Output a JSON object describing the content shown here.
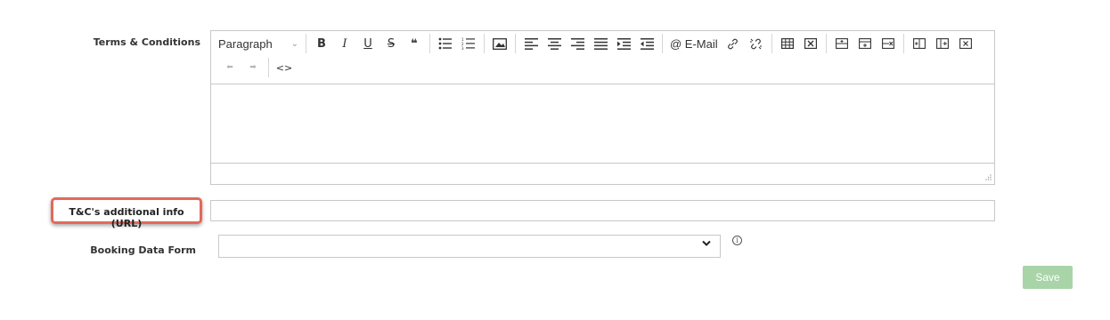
{
  "form": {
    "terms_label": "Terms & Conditions",
    "tc_url_label": "T&C's additional info (URL)",
    "booking_form_label": "Booking Data Form",
    "tc_url_value": "",
    "booking_form_selected": ""
  },
  "toolbar": {
    "paragraph_label": "Paragraph",
    "caret": "⌄",
    "bold": "B",
    "italic": "I",
    "underline": "U",
    "strike": "S",
    "quote": "❝",
    "email_label": "@ E-Mail",
    "undo": "⬅",
    "redo": "➡",
    "source": "<>"
  },
  "editor": {
    "content": ""
  },
  "info": "i",
  "chevron": "⌄",
  "save_label": "Save",
  "colors": {
    "highlight": "#e4685a",
    "save_bg": "#a8d4a8"
  }
}
